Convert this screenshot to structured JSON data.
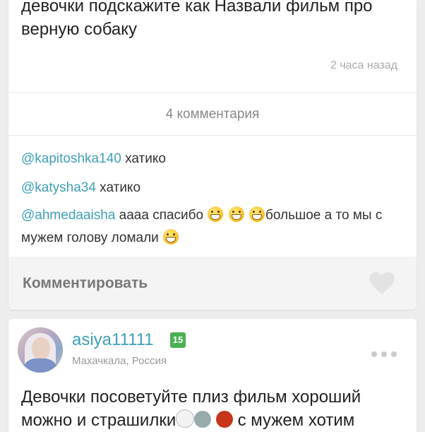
{
  "post1": {
    "text": "девочки подскажите как Назвали фильм про верную собаку",
    "time": "2 часа назад",
    "comments_count": "4 комментария",
    "comments": [
      {
        "user": "@kapitoshka140",
        "text": " хатико"
      },
      {
        "user": "@katysha34",
        "text": " хатико"
      },
      {
        "user": "@ahmedaaisha",
        "text_before": " аааа спасибо ",
        "text_after": "большое а то мы с мужем голову ломали "
      }
    ],
    "comment_button": "Комментировать",
    "icons": {
      "like": "heart-icon",
      "emoji": "grinning-face-emoji"
    }
  },
  "post2": {
    "username": "asiya11111",
    "level": "15",
    "location": "Махачкала, Россия",
    "text_before": "Девочки посоветуйте плиз фильм хороший можно и страшилки",
    "text_after": " с мужем хотим",
    "icons": {
      "more": "more-dots-icon",
      "emoji": [
        "ghost-emoji",
        "alien-emoji",
        "devil-emoji"
      ]
    }
  },
  "colors": {
    "accent": "#3ea0b8",
    "badge": "#4cb051"
  }
}
